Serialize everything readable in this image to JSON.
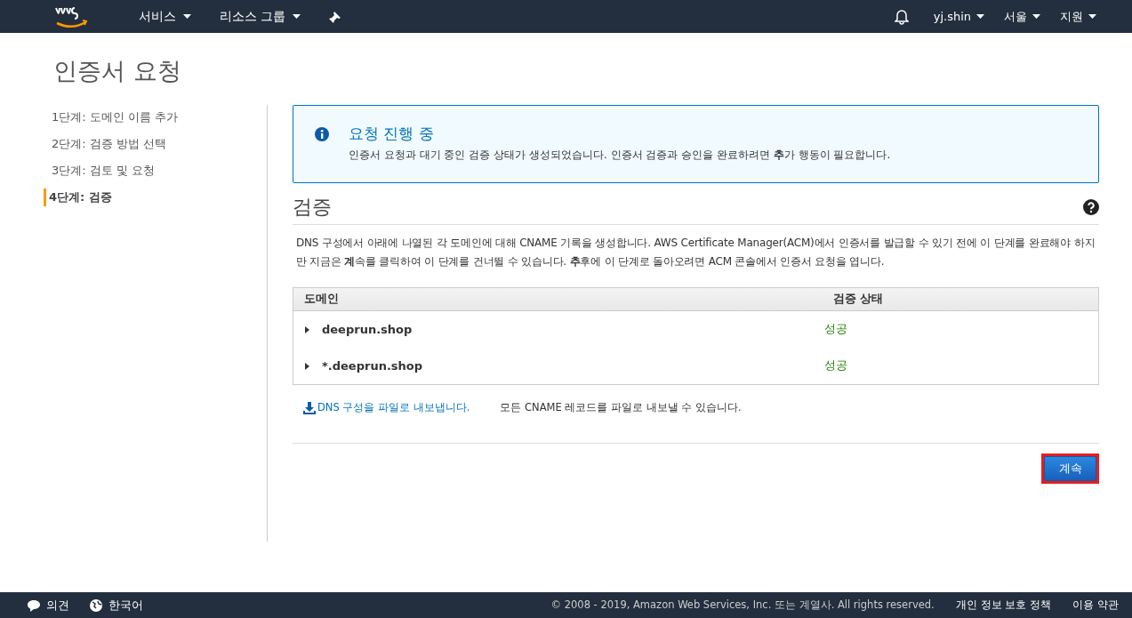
{
  "header": {
    "nav": [
      {
        "label": "서비스"
      },
      {
        "label": "리소스 그룹"
      }
    ],
    "account": [
      {
        "label": "yj.shin"
      },
      {
        "label": "서울"
      },
      {
        "label": "지원"
      }
    ]
  },
  "page_title": "인증서 요청",
  "steps": [
    {
      "label": "1단계: 도메인 이름 추가",
      "selected": false
    },
    {
      "label": "2단계: 검증 방법 선택",
      "selected": false
    },
    {
      "label": "3단계: 검토 및 요청",
      "selected": false
    },
    {
      "label": "4단계: 검증",
      "selected": true
    }
  ],
  "alert": {
    "title": "요청 진행 중",
    "message": "인증서 요청과 대기 중인 검증 상태가 생성되었습니다. 인증서 검증과 승인을 완료하려면 **추**가 행동이 필요합니다."
  },
  "section": {
    "title": "검증",
    "description": "DNS 구성에서 아래에 나열된 각 도메인에 대해 CNAME 기록을 생성합니다. AWS Certificate Manager(ACM)에서 인증서를 발급할 수 있기 전에 이 단계를 완료해야 하지만 지금은 **계**속를 클릭하여 이 단계를 건너뛸 수 있습니다. **추**후에 이 단계로 돌아오려면 ACM 콘솔에서 인증서 요청을 엽니다."
  },
  "table": {
    "columns": [
      "도메인",
      "검증 상태"
    ],
    "rows": [
      {
        "domain": "deeprun.shop",
        "status": "성공",
        "expanded": false
      },
      {
        "domain": "*.deeprun.shop",
        "status": "성공",
        "expanded": false
      }
    ]
  },
  "export": {
    "link": "DNS 구성을 파일로 내보냅니다.",
    "note": "모든 CNAME 레코드를 파일로 내보낼 수 있습니다."
  },
  "continue_button": {
    "label": "계속",
    "highlighted": true
  },
  "footer": {
    "feedback": "의견",
    "language": "한국어",
    "copyright": "© 2008 - 2019, Amazon Web Services, Inc. 또는 계열사. All rights reserved.",
    "links": [
      "개인 정보 보호 정책",
      "이용 약관"
    ]
  }
}
